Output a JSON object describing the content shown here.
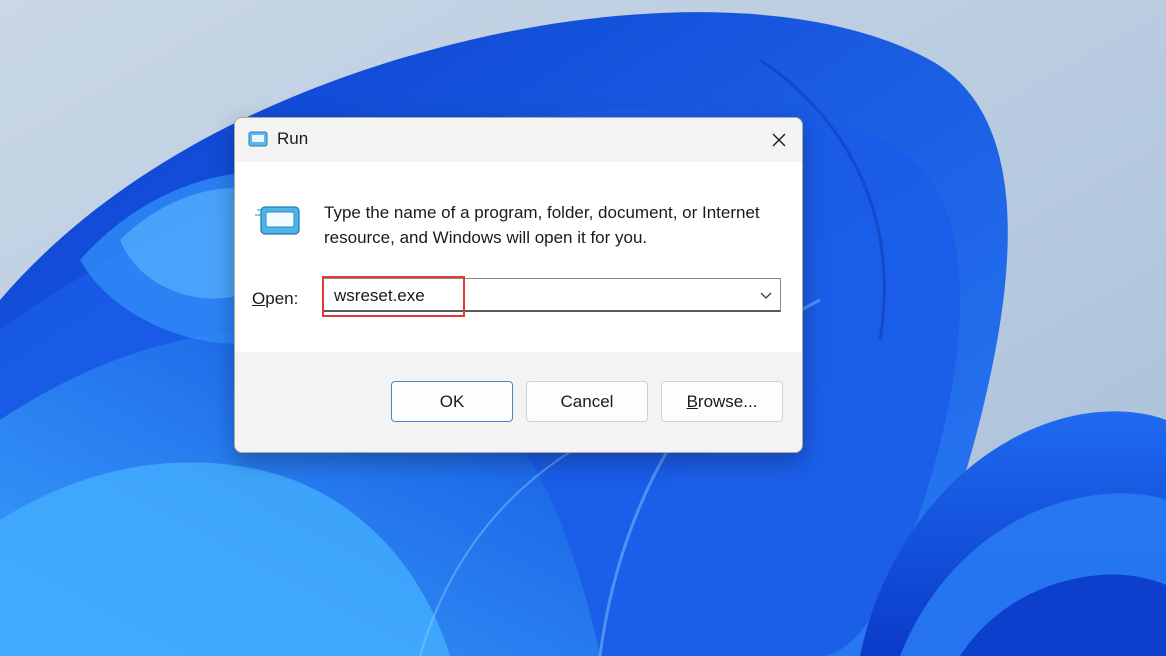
{
  "window": {
    "title": "Run",
    "title_icon": "run-app-icon",
    "close_icon": "close-icon"
  },
  "content": {
    "app_icon": "run-app-icon",
    "description": "Type the name of a program, folder, document, or Internet resource, and Windows will open it for you.",
    "open_label": "Open:",
    "open_label_accel": "O",
    "open_label_rest": "pen:",
    "open_value": "wsreset.exe",
    "dropdown_icon": "chevron-down-icon"
  },
  "buttons": {
    "ok": "OK",
    "cancel": "Cancel",
    "browse": "Browse...",
    "browse_accel": "B",
    "browse_rest": "rowse..."
  },
  "colors": {
    "highlight": "#e03a3a",
    "wallpaper_primary": "#1a5ce8",
    "wallpaper_background": "#b7cbe0"
  }
}
